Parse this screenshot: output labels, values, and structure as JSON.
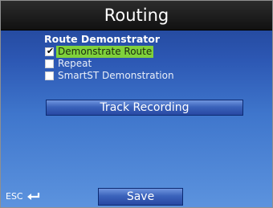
{
  "header": {
    "title": "Routing"
  },
  "route_demonstrator": {
    "heading": "Route Demonstrator",
    "options": [
      {
        "label": "Demonstrate Route",
        "checked": true,
        "selected": true
      },
      {
        "label": "Repeat",
        "checked": false,
        "selected": false
      },
      {
        "label": "SmartST Demonstration",
        "checked": false,
        "selected": false
      }
    ]
  },
  "buttons": {
    "track_recording": "Track Recording",
    "save": "Save",
    "esc": "ESC"
  },
  "icons": {
    "checkmark_glyph": "✔",
    "esc": "return-arrow-icon"
  },
  "colors": {
    "selection_highlight": "#7fd13b",
    "title_bar": "#1a1a1a"
  }
}
